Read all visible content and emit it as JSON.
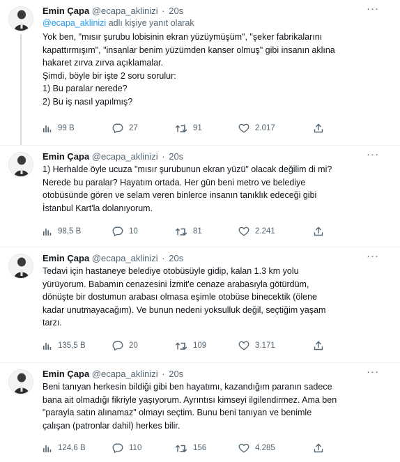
{
  "tweets": [
    {
      "author_name": "Emin Çapa",
      "handle": "@ecapa_aklinizi",
      "separator": "·",
      "time": "20s",
      "reply_mention": "@ecapa_aklinizi",
      "reply_suffix": "adlı kişiye yanıt olarak",
      "lines": [
        "Yok ben, \"mısır şurubu lobisinin ekran yüzüymüşüm\", \"şeker fabrikalarını",
        "kapattırmışım\", \"insanlar benim yüzümden kanser olmuş\" gibi insanın aklına",
        "hakaret zırva zırva açıklamalar.",
        "Şimdi, böyle bir işte 2 soru sorulur:",
        "1) Bu paralar nerede?",
        "2) Bu iş nasıl yapılmış?"
      ],
      "views": "99 B",
      "replies": "27",
      "retweets": "91",
      "likes": "2.017"
    },
    {
      "author_name": "Emin Çapa",
      "handle": "@ecapa_aklinizi",
      "separator": "·",
      "time": "20s",
      "lines": [
        "1) Herhalde öyle ucuza \"mısır şurubunun ekran yüzü\" olacak değilim di mi?",
        "Nerede bu paralar? Hayatım ortada. Her gün beni metro ve belediye",
        "otobüsünde gören ve selam veren binlerce insanın tanıklık edeceği gibi",
        "İstanbul Kart'la dolanıyorum."
      ],
      "views": "98,5 B",
      "replies": "10",
      "retweets": "81",
      "likes": "2.241"
    },
    {
      "author_name": "Emin Çapa",
      "handle": "@ecapa_aklinizi",
      "separator": "·",
      "time": "20s",
      "lines": [
        "Tedavi için hastaneye belediye otobüsüyle gidip, kalan 1.3 km yolu",
        "yürüyorum. Babamın cenazesini İzmit'e cenaze arabasıyla götürdüm,",
        "dönüşte bir dostumun arabası olmasa eşimle otobüse binecektik (ölene",
        "kadar unutmayacağım). Ve bunun nedeni yoksulluk değil, seçtiğim yaşam",
        "tarzı."
      ],
      "views": "135,5 B",
      "replies": "20",
      "retweets": "109",
      "likes": "3.171"
    },
    {
      "author_name": "Emin Çapa",
      "handle": "@ecapa_aklinizi",
      "separator": "·",
      "time": "20s",
      "lines": [
        "Beni tanıyan herkesin bildiği gibi ben hayatımı, kazandığım paranın sadece",
        "bana ait olmadığı fikriyle yaşıyorum. Ayrıntısı kimseyi ilgilendirmez. Ama ben",
        "\"parayla satın alınamaz\" olmayı seçtim. Bunu beni tanıyan ve benimle",
        "çalışan (patronlar dahil) herkes bilir."
      ],
      "views": "124,6 B",
      "replies": "110",
      "retweets": "156",
      "likes": "4.285"
    }
  ],
  "icons": {
    "views": "views-icon",
    "reply": "reply-icon",
    "retweet": "retweet-icon",
    "like": "like-icon",
    "share": "share-icon",
    "more": "more-icon"
  },
  "colors": {
    "text": "#0f1419",
    "secondary": "#536471",
    "link": "#1d9bf0",
    "divider": "#eff3f4",
    "thread_line": "#cfd9de"
  }
}
